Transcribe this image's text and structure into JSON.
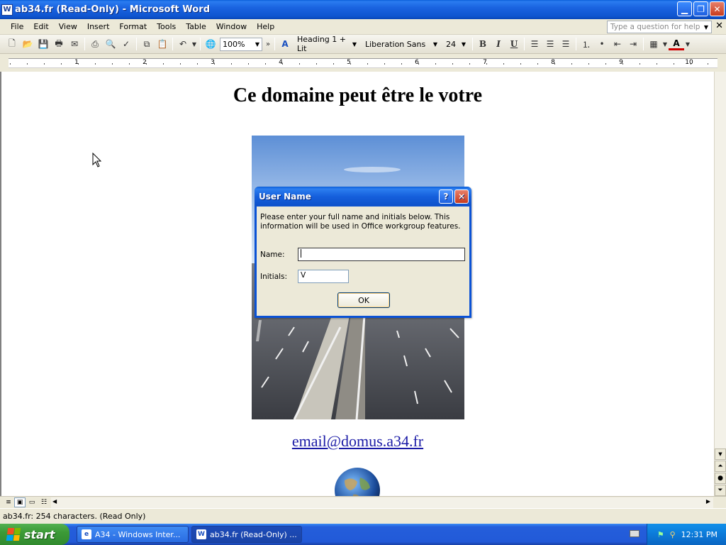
{
  "window": {
    "title": "ab34.fr (Read-Only) - Microsoft Word",
    "app_icon": "W"
  },
  "menu": {
    "items": [
      "File",
      "Edit",
      "View",
      "Insert",
      "Format",
      "Tools",
      "Table",
      "Window",
      "Help"
    ],
    "help_placeholder": "Type a question for help"
  },
  "toolbar": {
    "zoom": "100%",
    "style": "Heading 1 + Lit",
    "font": "Liberation Sans",
    "size": "24",
    "bold_label": "B",
    "italic_label": "I",
    "underline_label": "U",
    "font_color_label": "A"
  },
  "ruler": {
    "numbers": [
      "1",
      "2",
      "3",
      "4",
      "5",
      "6",
      "7",
      "8",
      "9",
      "10"
    ]
  },
  "document": {
    "heading": "Ce domaine peut être le votre",
    "email": "email@domus.a34.fr"
  },
  "dialog": {
    "title": "User Name",
    "help_glyph": "?",
    "close_glyph": "✕",
    "message": "Please enter your full name and initials below.  This information will be used in Office workgroup features.",
    "name_label": "Name:",
    "name_value": "",
    "initials_label": "Initials:",
    "initials_value": "V",
    "ok_label": "OK"
  },
  "statusbar": {
    "text": "ab34.fr: 254 characters.  (Read Only)"
  },
  "taskbar": {
    "start_label": "start",
    "tasks": [
      {
        "label": "A34 - Windows Inter...",
        "icon": "e"
      },
      {
        "label": "ab34.fr (Read-Only) ...",
        "icon": "W"
      }
    ],
    "clock": "12:31 PM"
  },
  "colors": {
    "titlebar_blue": "#0f55d0",
    "link_blue": "#1a1aa6",
    "start_green": "#3c9a37"
  }
}
